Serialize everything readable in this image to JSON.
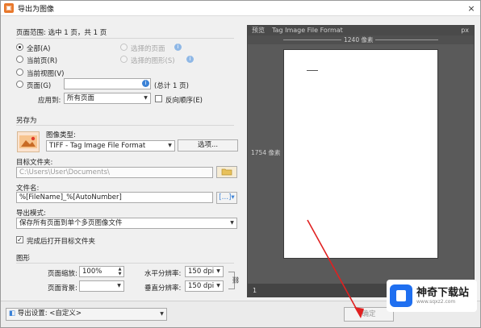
{
  "window": {
    "title": "导出为图像",
    "close_glyph": "×"
  },
  "page_range": {
    "header": "页面范围: 选中 1 页，共 1 页",
    "all": "全部(A)",
    "current_page": "当前页(R)",
    "current_view": "当前视图(V)",
    "pages": "页面(G)",
    "pages_value": "",
    "pages_total": "(总计 1 页)",
    "selected_pages": "选择的页面",
    "selected_graphics": "选择的图形(S)",
    "apply_to_label": "应用到:",
    "apply_to_value": "所有页面",
    "reverse_order": "反向顺序(E)"
  },
  "save_as": {
    "header": "另存为",
    "image_type_label": "图像类型:",
    "image_type_value": "TIFF - Tag Image File Format",
    "options_button": "选项...",
    "target_folder_label": "目标文件夹:",
    "target_folder_value": "C:\\Users\\User\\Documents\\",
    "file_name_label": "文件名:",
    "file_name_value": "%[FileName]_%[AutoNumber]",
    "export_mode_label": "导出模式:",
    "export_mode_value": "保存所有页面到单个多页图像文件",
    "open_folder_after": "完成后打开目标文件夹",
    "open_folder_checked": true
  },
  "graphics": {
    "header": "图形",
    "page_zoom_label": "页面缩放:",
    "page_zoom_value": "100%",
    "page_background_label": "页面背景:",
    "h_resolution_label": "水平分辨率:",
    "h_resolution_value": "150 dpi",
    "v_resolution_label": "垂直分辨率:",
    "v_resolution_value": "150 dpi"
  },
  "preview": {
    "header_left": "预览",
    "header_title": "Tag Image File Format",
    "header_right": "px",
    "ruler_top": "1240 像素",
    "ruler_left": "1754 像素",
    "page_number": "1"
  },
  "footer": {
    "export_settings": "导出设置: <自定义>",
    "ok_button": "确定"
  },
  "watermark": {
    "title": "神奇下载站",
    "url": "www.sqxz2.com"
  },
  "colors": {
    "arrow": "#e02020",
    "accent_blue": "#3b82d6"
  }
}
